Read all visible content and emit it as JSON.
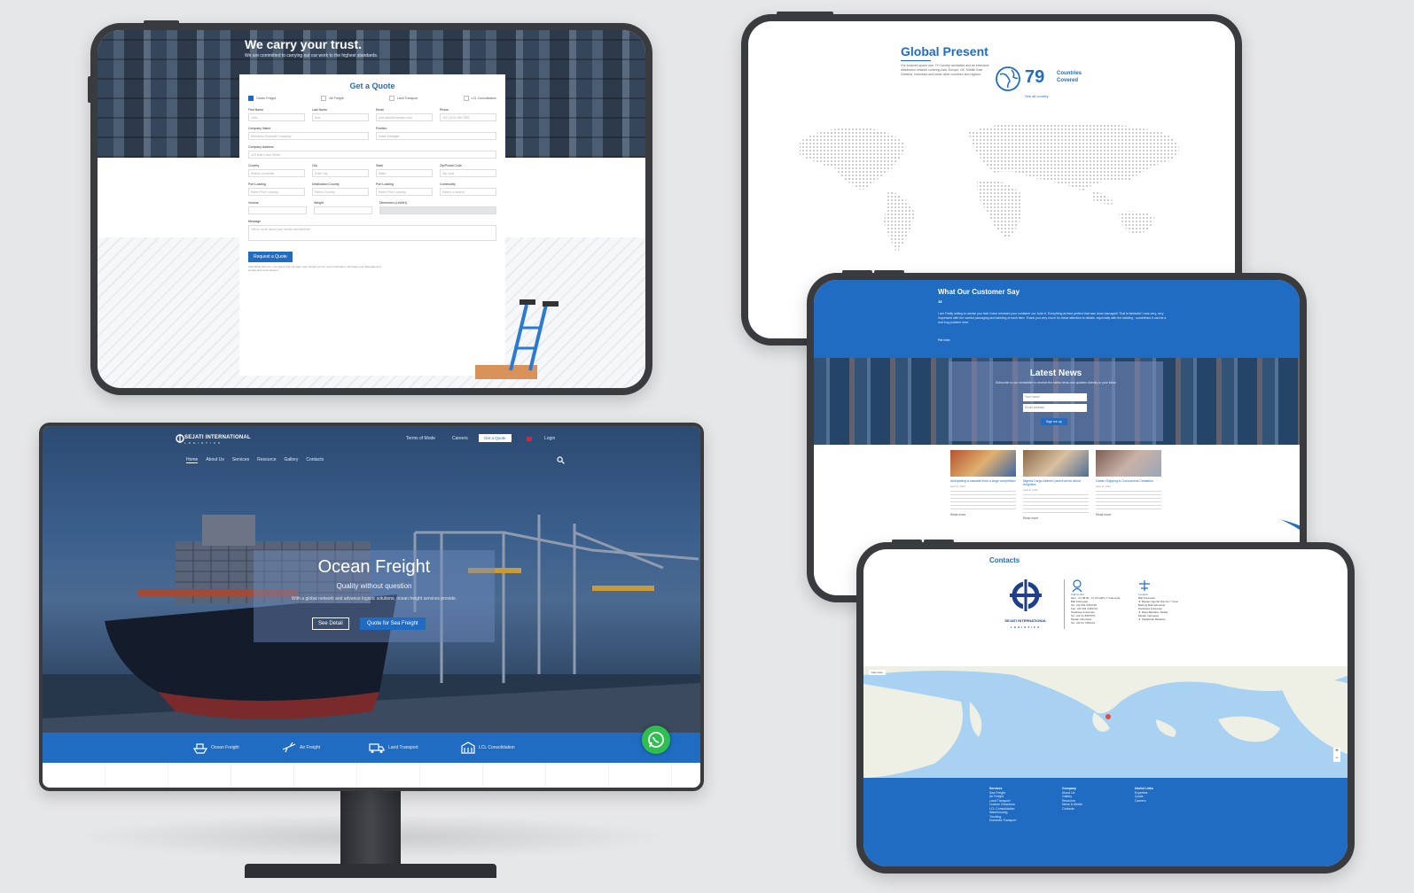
{
  "quote_page": {
    "slogan": "We carry your trust.",
    "subtitle": "We are committed to carrying out our work to the highest standards.",
    "form_title": "Get a Quote",
    "services": [
      {
        "label": "Ocean Freight",
        "checked": true
      },
      {
        "label": "Air Freight",
        "checked": false
      },
      {
        "label": "Land Transport",
        "checked": false
      },
      {
        "label": "LCL Consolidation",
        "checked": false
      }
    ],
    "fields": {
      "first_name": {
        "label": "First Name",
        "placeholder": "John"
      },
      "last_name": {
        "label": "Last Name",
        "placeholder": "Doe"
      },
      "email": {
        "label": "Email",
        "placeholder": "john.doe@example.com"
      },
      "phone": {
        "label": "Phone",
        "placeholder": "+62 (123) 456 7890"
      },
      "company_name": {
        "label": "Company Name",
        "placeholder": "Mechanic Example Company"
      },
      "position": {
        "label": "Position",
        "placeholder": "Sales Manager"
      },
      "company_address": {
        "label": "Company Address",
        "placeholder": "123 Main Lane Street"
      },
      "country": {
        "label": "Country",
        "placeholder": "Search countries"
      },
      "city": {
        "label": "City",
        "placeholder": "Enter city"
      },
      "state": {
        "label": "State",
        "placeholder": "State"
      },
      "zip": {
        "label": "Zip/Postal Code",
        "placeholder": "Zip code"
      },
      "port_loading": {
        "label": "Port Loading",
        "placeholder": "Select Port Loading"
      },
      "destination_country": {
        "label": "Destination Country",
        "placeholder": "Select Country"
      },
      "port_loading_2": {
        "label": "Port Loading",
        "placeholder": "Select Port Loading"
      },
      "commodity": {
        "label": "Commodity",
        "placeholder": "Select or search"
      },
      "volume": {
        "label": "Volume",
        "placeholder": ""
      },
      "weight": {
        "label": "Weight",
        "placeholder": ""
      },
      "dimension": {
        "label": "Dimension (LxWxH)",
        "placeholder": ""
      },
      "message": {
        "label": "Message",
        "placeholder": "Tell us more about your needs and timeline"
      }
    },
    "submit_label": "Request a Quote",
    "disclaimer": "Submitting this form, you agree that our team may contact you for more information. We keep your data safe and private and never share it."
  },
  "global_page": {
    "title": "Global Present",
    "paragraph": "Our footprint spans over 79 Country worldwide and an extensive distribution network covering Asia, Europe, UK, Middle East Oceania, Indonesia and some other countries and regions.",
    "count": "79",
    "count_label": "Countries Covered",
    "see_all": "See all country"
  },
  "testimonial_page": {
    "title": "What Our Customer Say",
    "quote_mark": "“",
    "quote": "I am Firstly writing to advise you that I have received your container our June 6. Everything arrived perfect that was done damaged! That is fantastic! I was very, very impressed with the careful packaging and labeling of each item. Thank you very much for these attention to details, especially with the labeling - sometimes it can be a real bug problem here.",
    "author": "Pat Irwin",
    "news_title": "Latest News",
    "news_subtitle": "Subscribe to our newsletter to receive the latest news and updates directly to your inbox",
    "name_placeholder": "Your name",
    "email_placeholder": "Email address",
    "signup_label": "Sign me up",
    "articles": [
      {
        "title": "Anticipating a cascade from a large competition",
        "date": "April 8, 2022",
        "more": "Read more"
      },
      {
        "title": "Nigeria Cargo Airlines' parent arrive about freighters",
        "date": "April 8, 2022",
        "more": "Read more"
      },
      {
        "title": "Ocean Shipping in Coronavirus Cessation",
        "date": "April 8, 2022",
        "more": "Read more"
      }
    ]
  },
  "contacts_page": {
    "title": "Contacts",
    "brand": "SEJATI INTERNATIONAL",
    "brand_sub": "LOGISTICS",
    "call_center_title": "Call Center",
    "call_center_lines": [
      "Mon - Fri 08.00 - 17.00 GMT+7 Indonesia",
      "Bali Indonesia",
      "Tel: +62 361 4454720",
      "Fax: +62 361 4454721",
      "Surabaya Indonesia",
      "Tel: +62 31 8437070",
      "Medan Indonesia",
      "Tel: +62 61 7363141"
    ],
    "location_title": "Location",
    "location_lines": [
      "Bali Indonesia",
      "Jl. Bypass Ngurah Rai No.7, Kuta",
      "Badung Bali Indonesia",
      "Surabaya Indonesia",
      "Jl. Raya Bandara, Sedati",
      "Medan Indonesia",
      "Jl. Pelabuhan Belawan"
    ],
    "map_label": "Map data",
    "footer": {
      "services": {
        "title": "Services",
        "items": [
          "Sea Freight",
          "Air Freight",
          "Land Transport",
          "Custom Clearance",
          "LCL Consolidation",
          "Warehousing",
          "Trucking",
          "Domestic Transport"
        ]
      },
      "company": {
        "title": "Company",
        "items": [
          "About Us",
          "Gallery",
          "Resource",
          "News & Media",
          "Contacts"
        ]
      },
      "useful": {
        "title": "Useful Links",
        "items": [
          "Expertise",
          "Quote",
          "Careers"
        ]
      }
    }
  },
  "home_page": {
    "brand": "SEJATI INTERNATIONAL",
    "brand_sub": "LOGISTICS",
    "util_links": [
      "Terms of Mode",
      "Careers"
    ],
    "get_quote": "Get a Quote",
    "login": "Login",
    "nav": [
      "Home",
      "About Us",
      "Services",
      "Resource",
      "Gallery",
      "Contacts"
    ],
    "hero_title": "Ocean Freight",
    "hero_tagline": "Quality without question",
    "hero_desc": "With a global network and advance logistic solutions, ocean freight services provide.",
    "btn_detail": "See Detail",
    "btn_quote": "Quote for Sea Freight",
    "services": [
      "Ocean Freight",
      "Air Freight",
      "Land Transport",
      "LCL Consolidation"
    ]
  },
  "colors": {
    "brand_blue": "#1f6cc2",
    "whatsapp_green": "#2ebf4f"
  },
  "icons": [
    "globe-icon",
    "phone-icon",
    "location-icon",
    "search-icon",
    "whatsapp-icon",
    "ship-icon",
    "plane-icon",
    "truck-icon",
    "container-icon"
  ]
}
